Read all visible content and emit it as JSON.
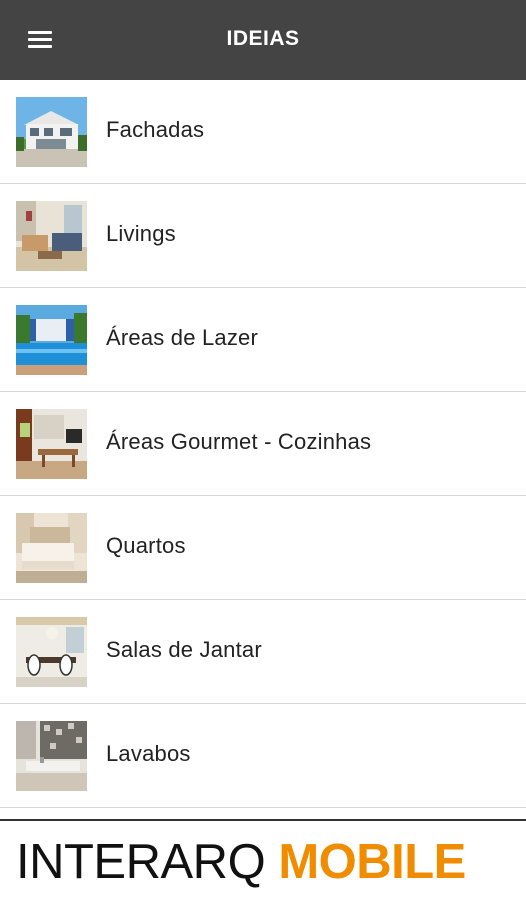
{
  "appbar": {
    "title": "IDEIAS",
    "menu_icon": "menu-icon"
  },
  "items": [
    {
      "label": "Fachadas",
      "thumb": "facade-thumbnail"
    },
    {
      "label": "Livings",
      "thumb": "living-room-thumbnail"
    },
    {
      "label": "Áreas de Lazer",
      "thumb": "pool-thumbnail"
    },
    {
      "label": "Áreas Gourmet - Cozinhas",
      "thumb": "kitchen-thumbnail"
    },
    {
      "label": "Quartos",
      "thumb": "bedroom-thumbnail"
    },
    {
      "label": "Salas de Jantar",
      "thumb": "dining-room-thumbnail"
    },
    {
      "label": "Lavabos",
      "thumb": "washroom-thumbnail"
    }
  ],
  "footer": {
    "brand_part1": "INTERARQ",
    "brand_part2": "MOBILE"
  },
  "colors": {
    "appbar": "#444444",
    "accent": "#f08c00",
    "divider": "#d6d6d6"
  }
}
